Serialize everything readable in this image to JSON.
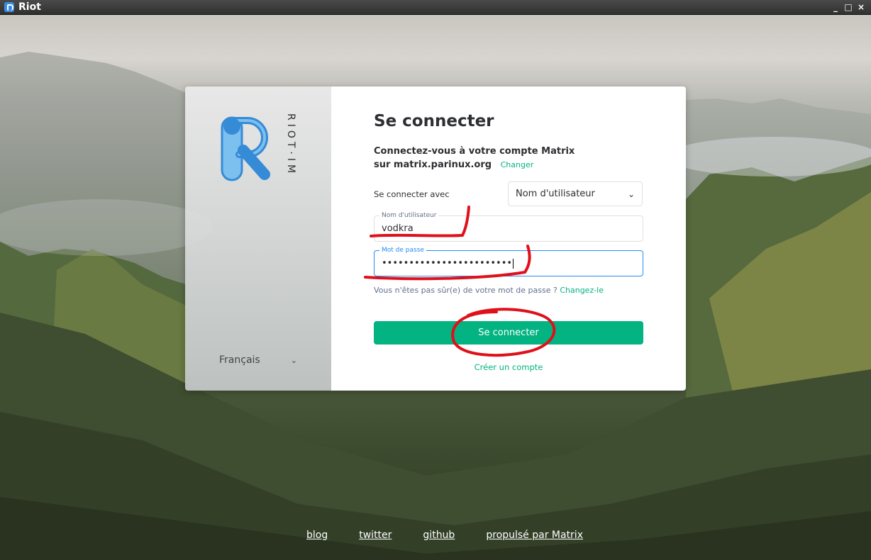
{
  "window": {
    "title": "Riot",
    "controls": {
      "minimize": "_",
      "maximize": "□",
      "close": "×"
    }
  },
  "brand": {
    "name": "RIOT·IM",
    "icon": "riot-logo-icon"
  },
  "language": {
    "selected": "Français"
  },
  "login": {
    "title": "Se connecter",
    "server_text": "Connectez-vous à votre compte Matrix sur matrix.parinux.org",
    "change_link": "Changer",
    "login_with_label": "Se connecter avec",
    "login_type": "Nom d'utilisateur",
    "username": {
      "label": "Nom d'utilisateur",
      "value": "vodkra"
    },
    "password": {
      "label": "Mot de passe",
      "value": "••••••••••••••••••••••••"
    },
    "forgot_text": "Vous n'êtes pas sûr(e) de votre mot de passe ?",
    "forgot_link": "Changez-le",
    "submit": "Se connecter",
    "create_account": "Créer un compte"
  },
  "footer": {
    "links": [
      "blog",
      "twitter",
      "github",
      "propulsé par Matrix"
    ]
  },
  "colors": {
    "accent": "#03b381",
    "focus": "#238cf5",
    "logo": "#368bd6",
    "annotation": "#e0101a"
  }
}
